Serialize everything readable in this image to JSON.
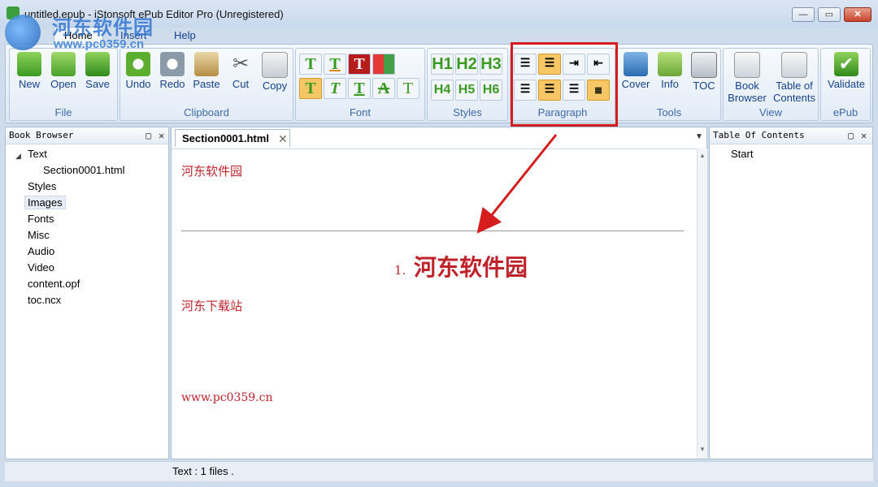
{
  "window": {
    "title": "untitled.epub - iStonsoft ePub Editor Pro (Unregistered)"
  },
  "watermark": {
    "text1": "河东软件园",
    "text2": "www.pc0359.cn"
  },
  "menu": {
    "tabs": [
      "Home",
      "Insert",
      "Help"
    ]
  },
  "ribbon": {
    "groups": {
      "file": {
        "label": "File",
        "buttons": [
          "New",
          "Open",
          "Save"
        ]
      },
      "clipboard": {
        "label": "Clipboard",
        "buttons": [
          "Undo",
          "Redo",
          "Paste",
          "Cut",
          "Copy"
        ]
      },
      "font": {
        "label": "Font"
      },
      "styles": {
        "label": "Styles",
        "h": [
          "H1",
          "H2",
          "H3",
          "H4",
          "H5",
          "H6"
        ]
      },
      "paragraph": {
        "label": "Paragraph"
      },
      "tools": {
        "label": "Tools",
        "buttons": [
          "Cover",
          "Info",
          "TOC"
        ]
      },
      "view": {
        "label": "View",
        "book1": "Book",
        "book2": "Browser",
        "toc1": "Table of",
        "toc2": "Contents"
      },
      "epub": {
        "label": "ePub",
        "buttons": [
          "Validate"
        ]
      }
    }
  },
  "book_browser": {
    "title": "Book Browser",
    "items": [
      "Text",
      "Section0001.html",
      "Styles",
      "Images",
      "Fonts",
      "Misc",
      "Audio",
      "Video",
      "content.opf",
      "toc.ncx"
    ]
  },
  "editor": {
    "tab_label": "Section0001.html",
    "lines": {
      "l1": "河东软件园",
      "num": "1.",
      "h1": "河东软件园",
      "l2": "河东下载站",
      "l3": "www.pc0359.cn"
    }
  },
  "toc_panel": {
    "title": "Table Of Contents",
    "items": [
      "Start"
    ]
  },
  "status": {
    "text": "Text : 1 files ."
  },
  "colors": {
    "accent": "#15428b",
    "highlight": "#d61d1d",
    "doc_text": "#c0222a"
  }
}
